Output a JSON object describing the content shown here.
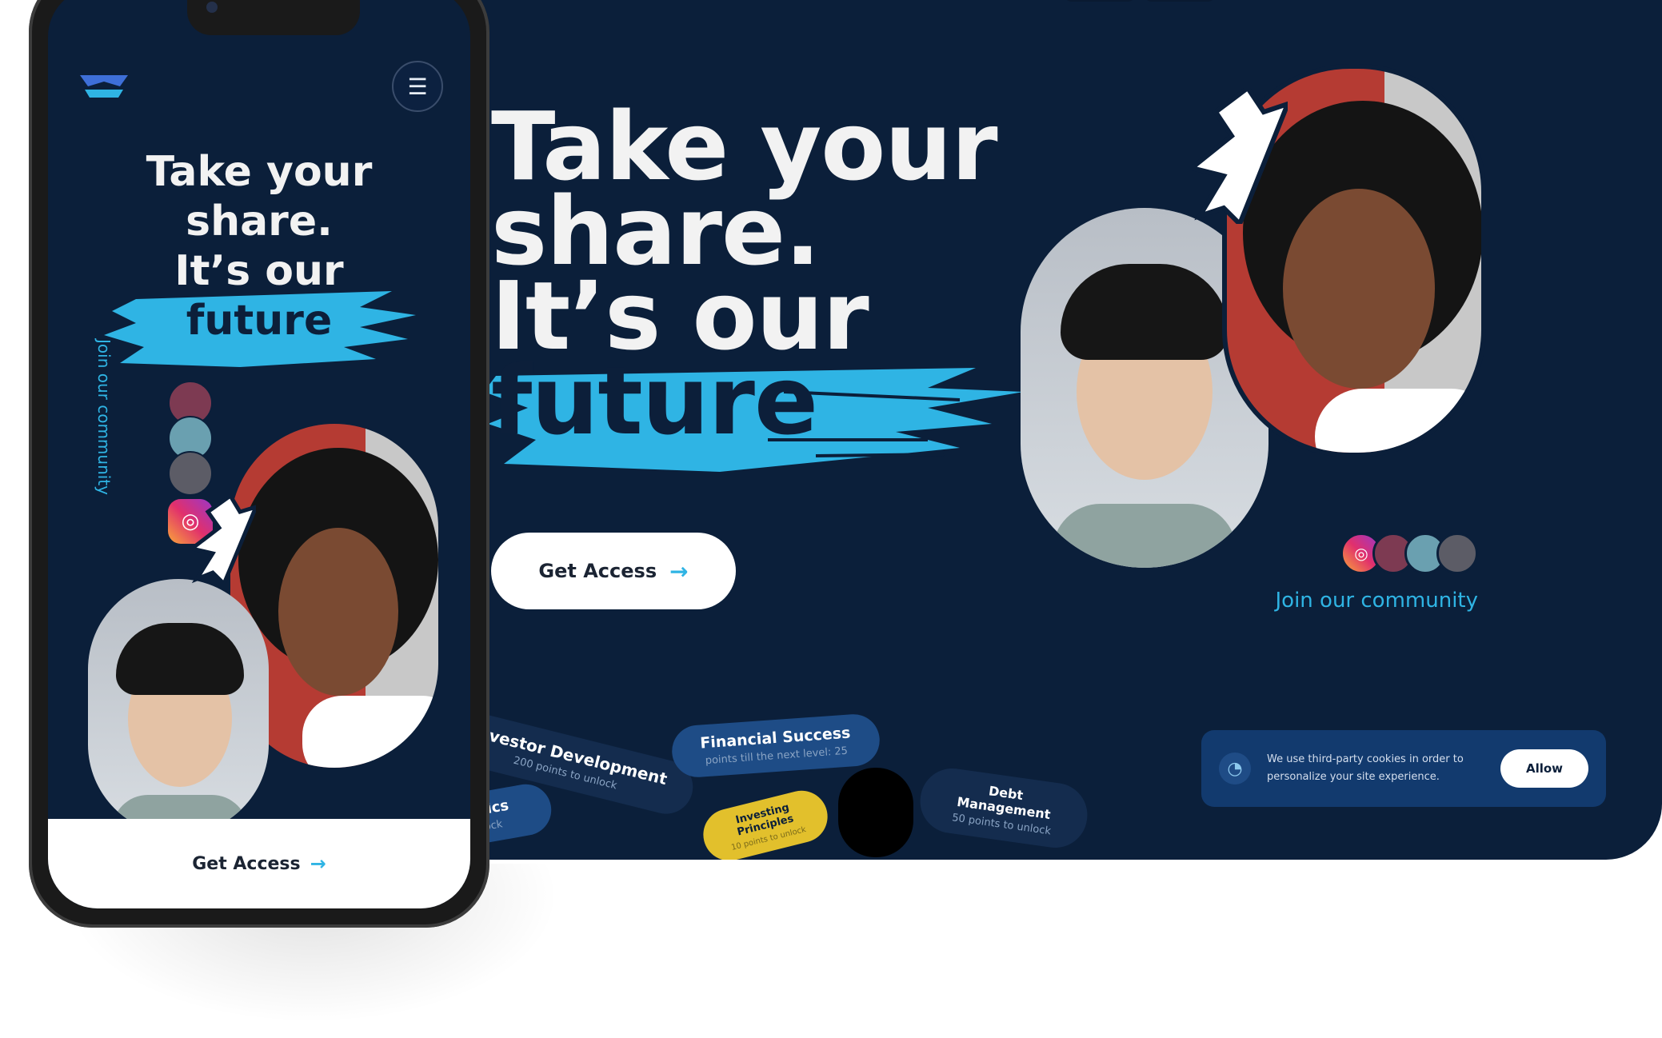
{
  "desktop": {
    "hero_lines": [
      "Take your",
      "share.",
      "It’s our"
    ],
    "hero_highlight": "future",
    "cta_label": "Get Access",
    "cta_arrow": "→",
    "community_label": "Join our community",
    "pills": [
      {
        "title": "Investor Development",
        "sub": "200 points to unlock"
      },
      {
        "title": "gistics",
        "sub": "unlock"
      },
      {
        "title": "Financial Success",
        "sub": "points till the next level: 25"
      },
      {
        "title": "Investing Principles",
        "sub": "10 points to unlock"
      },
      {
        "title": "Debt Management",
        "sub": "50 points to unlock"
      }
    ],
    "cookie": {
      "text": "We use third-party cookies in order to personalize your site experience.",
      "allow_label": "Allow"
    }
  },
  "mobile": {
    "title_lines": [
      "Take your",
      "share.",
      "It’s our"
    ],
    "title_highlight": "future",
    "vertical_label": "Join our community",
    "bottom_cta": "Get Access",
    "bottom_arrow": "→"
  },
  "icons": {
    "apple": "apple-icon",
    "instagram": "instagram-icon",
    "menu": "menu-icon",
    "cookie": "cookie-icon"
  },
  "colors": {
    "navy": "#0b1f3a",
    "accent": "#2fb4e4",
    "portrait_red": "#b53b33"
  }
}
